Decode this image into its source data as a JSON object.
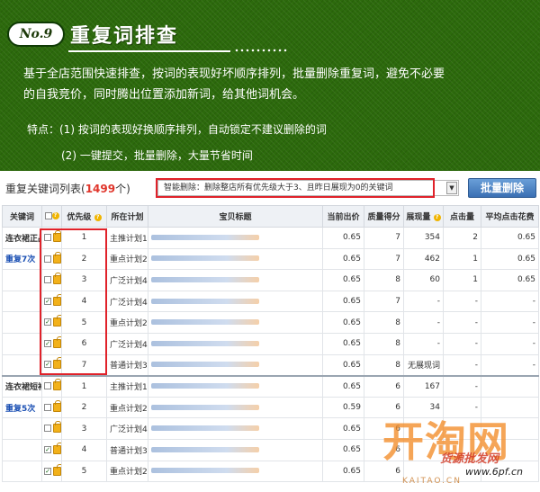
{
  "banner": {
    "badge": "No.9",
    "title": "重复词排查",
    "desc1": "基于全店范围快速排查，按词的表现好坏顺序排列，批量删除重复词，避免不必要",
    "desc2": "的自我竞价，同时腾出位置添加新词，给其他词机会。",
    "feature1": "特点：(1) 按词的表现好换顺序排列，自动锁定不建议删除的词",
    "feature2": "(2) 一键提交，批量删除，大量节省时间"
  },
  "toolbar": {
    "list_title": "重复关键词列表(",
    "count": "1499",
    "list_title_suffix": "个)",
    "smart_delete_text": "智能删除：删除整店所有优先级大于3、且昨日展现为0的关键词",
    "bulk_delete_label": "批量删除"
  },
  "table": {
    "headers": {
      "keyword": "关键词",
      "priority": "优先级",
      "plan": "所在计划",
      "title": "宝贝标题",
      "bid": "当前出价",
      "quality": "质量得分",
      "impressions": "展现量",
      "clicks": "点击量",
      "avg_cost": "平均点击花费"
    },
    "groups": [
      {
        "keyword": "连衣裙正品",
        "repeat": "重复7次",
        "rows": [
          {
            "checked": false,
            "locked": true,
            "priority": "1",
            "plan": "主推计划1",
            "bid": "0.65",
            "quality": "7",
            "impressions": "354",
            "clicks": "2",
            "avg": "0.65"
          },
          {
            "checked": false,
            "locked": true,
            "priority": "2",
            "plan": "重点计划2",
            "bid": "0.65",
            "quality": "7",
            "impressions": "462",
            "clicks": "1",
            "avg": "0.65"
          },
          {
            "checked": false,
            "locked": true,
            "priority": "3",
            "plan": "广泛计划4",
            "bid": "0.65",
            "quality": "8",
            "impressions": "60",
            "clicks": "1",
            "avg": "0.65"
          },
          {
            "checked": true,
            "locked": false,
            "priority": "4",
            "plan": "广泛计划4",
            "bid": "0.65",
            "quality": "7",
            "impressions": "-",
            "clicks": "-",
            "avg": "-"
          },
          {
            "checked": true,
            "locked": false,
            "priority": "5",
            "plan": "重点计划2",
            "bid": "0.65",
            "quality": "8",
            "impressions": "-",
            "clicks": "-",
            "avg": "-"
          },
          {
            "checked": true,
            "locked": false,
            "priority": "6",
            "plan": "广泛计划4",
            "bid": "0.65",
            "quality": "8",
            "impressions": "-",
            "clicks": "-",
            "avg": "-"
          },
          {
            "checked": true,
            "locked": false,
            "priority": "7",
            "plan": "普通计划3",
            "bid": "0.65",
            "quality": "8",
            "impressions": "无展现词",
            "clicks": "-",
            "avg": "-"
          }
        ]
      },
      {
        "keyword": "连衣裙短袖",
        "repeat": "重复5次",
        "rows": [
          {
            "checked": false,
            "locked": true,
            "priority": "1",
            "plan": "主推计划1",
            "bid": "0.65",
            "quality": "6",
            "impressions": "167",
            "clicks": "-",
            "avg": ""
          },
          {
            "checked": false,
            "locked": true,
            "priority": "2",
            "plan": "重点计划2",
            "bid": "0.59",
            "quality": "6",
            "impressions": "34",
            "clicks": "-",
            "avg": ""
          },
          {
            "checked": false,
            "locked": true,
            "priority": "3",
            "plan": "广泛计划4",
            "bid": "0.65",
            "quality": "6",
            "impressions": "",
            "clicks": "",
            "avg": ""
          },
          {
            "checked": true,
            "locked": false,
            "priority": "4",
            "plan": "普通计划3",
            "bid": "0.65",
            "quality": "6",
            "impressions": "",
            "clicks": "",
            "avg": ""
          },
          {
            "checked": true,
            "locked": false,
            "priority": "5",
            "plan": "重点计划2",
            "bid": "0.65",
            "quality": "6",
            "impressions": "",
            "clicks": "",
            "avg": ""
          }
        ]
      }
    ]
  },
  "watermark": {
    "main": "开淘网",
    "sub": "货源批发网",
    "url": "www.6pf.cn",
    "kaitao": "KAITAO.CN"
  },
  "colors": {
    "banner_green": "#2c6a0c",
    "highlight_red": "#e0222a",
    "count_red": "#e0352b",
    "button_blue": "#3a6fb3",
    "link_blue": "#1a4fb3",
    "lock_yellow": "#f2b11a"
  }
}
